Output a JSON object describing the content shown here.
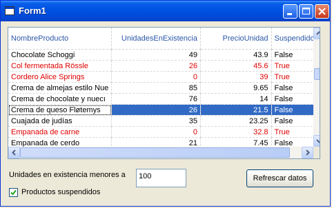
{
  "window": {
    "title": "Form1"
  },
  "grid": {
    "columns": [
      "NombreProducto",
      "UnidadesEnExistencia",
      "PrecioUnidad",
      "Suspendido"
    ],
    "rows": [
      {
        "cells": [
          "Chocolate Schoggi",
          "49",
          "43.9",
          "False"
        ],
        "style": "normal"
      },
      {
        "cells": [
          "Col fermentada Rössle",
          "26",
          "45.6",
          "True"
        ],
        "style": "red"
      },
      {
        "cells": [
          "Cordero Alice Springs",
          "0",
          "39",
          "True"
        ],
        "style": "red"
      },
      {
        "cells": [
          "Crema de almejas estilo Nue",
          "85",
          "9.65",
          "False"
        ],
        "style": "normal"
      },
      {
        "cells": [
          "Crema de chocolate y nuecı",
          "76",
          "14",
          "False"
        ],
        "style": "normal"
      },
      {
        "cells": [
          "Crema de queso Fløtemys",
          "26",
          "21.5",
          "False"
        ],
        "style": "selected"
      },
      {
        "cells": [
          "Cuajada de judías",
          "35",
          "23.25",
          "False"
        ],
        "style": "normal"
      },
      {
        "cells": [
          "Empanada de carne",
          "0",
          "32.8",
          "True"
        ],
        "style": "red"
      },
      {
        "cells": [
          "Empanada de cerdo",
          "21",
          "7.45",
          "False"
        ],
        "style": "normal"
      }
    ]
  },
  "filter": {
    "label": "Unidades en existencia menores a",
    "value": "100"
  },
  "refresh_button": "Refrescar datos",
  "suspended_checkbox": {
    "label": "Productos suspendidos",
    "checked": true
  },
  "colors": {
    "title_bar": "#0054e3",
    "selection": "#316ac5",
    "red_row": "#e00000",
    "header_text": "#2b57a8"
  }
}
